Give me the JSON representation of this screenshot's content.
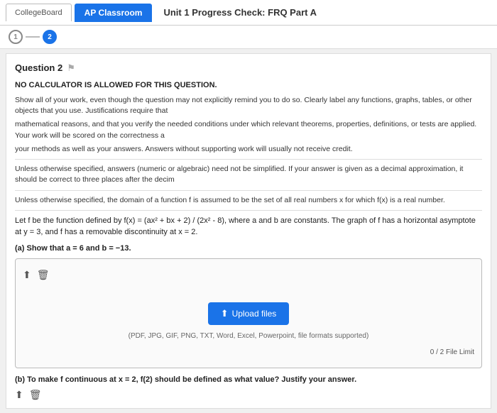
{
  "topbar": {
    "tab_college_board": "CollegeBoard",
    "tab_ap_classroom": "AP Classroom",
    "tab_title": "Unit 1 Progress Check: FRQ Part A"
  },
  "breadcrumb": {
    "step1": "1",
    "step2": "2"
  },
  "question": {
    "number": "Question 2",
    "flag_label": "flag",
    "no_calculator": "NO CALCULATOR IS ALLOWED FOR THIS QUESTION.",
    "instruction1": "Show all of your work, even though the question may not explicitly remind you to do so. Clearly label any functions, graphs, tables, or other objects that you use. Justifications require that",
    "instruction2": "mathematical reasons, and that you verify the needed conditions under which relevant theorems, properties, definitions, or tests are applied. Your work will be scored on the correctness a",
    "instruction3": "your methods as well as your answers. Answers without supporting work will usually not receive credit.",
    "instruction4": "Unless otherwise specified, answers (numeric or algebraic) need not be simplified. If your answer is given as a decimal approximation, it should be correct to three places after the decim",
    "instruction5": "Unless otherwise specified, the domain of a function f is assumed to be the set of all real numbers x for which f(x) is a real number.",
    "problem_text": "Let f be the function defined by f(x) = (ax² + bx + 2) / (2x² - 8), where a and b are constants. The graph of f has a horizontal asymptote at y = 3, and f has a removable discontinuity at x = 2.",
    "part_a_label": "(a) Show that a = 6 and b = −13.",
    "part_b_label": "(b) To make f continuous at x = 2, f(2) should be defined as what value? Justify your answer."
  },
  "upload": {
    "upload_btn_label": "Upload files",
    "formats_text": "(PDF, JPG, GIF, PNG, TXT, Word, Excel, Powerpoint, file formats supported)",
    "file_limit_text": "0 / 2 File Limit"
  },
  "icons": {
    "upload_icon": "⬆",
    "trash_icon": "🗑",
    "flag_icon": "⚑"
  }
}
